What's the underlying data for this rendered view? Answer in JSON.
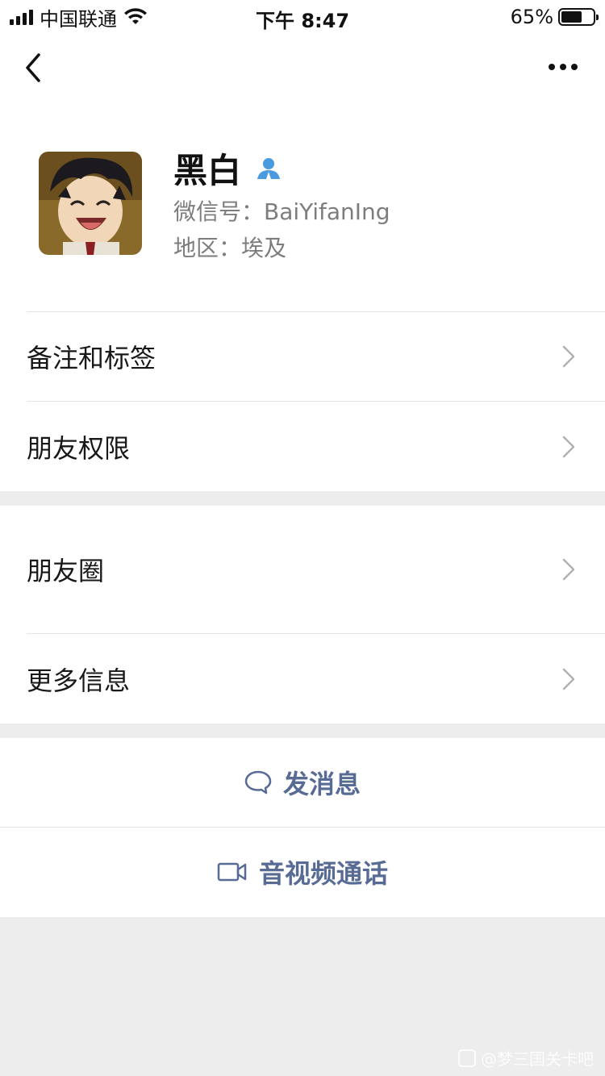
{
  "status_bar": {
    "carrier": "中国联通",
    "time": "下午 8:47",
    "battery_percent": "65%",
    "battery_level": 0.65,
    "wifi_icon": "wifi-icon",
    "signal_icon": "signal-icon"
  },
  "nav": {
    "back_icon": "chevron-left-icon",
    "more_icon": "more-dots-icon"
  },
  "profile": {
    "name": "黑白",
    "badge_icon": "contact-person-icon",
    "wechat_id": "微信号：BaiYifanIng",
    "region": "地区：埃及",
    "avatar": "anime-avatar"
  },
  "menu": [
    {
      "label": "备注和标签"
    },
    {
      "label": "朋友权限"
    },
    {
      "label": "朋友圈"
    },
    {
      "label": "更多信息"
    }
  ],
  "actions": {
    "message": {
      "label": "发消息",
      "icon": "chat-bubble-icon"
    },
    "call": {
      "label": "音视频通话",
      "icon": "video-camera-icon"
    }
  },
  "watermark": "@梦三国关卡吧",
  "colors": {
    "link": "#576b95",
    "background": "#ededed",
    "secondary_text": "#7d7d7d",
    "badge": "#4a9ae0"
  }
}
